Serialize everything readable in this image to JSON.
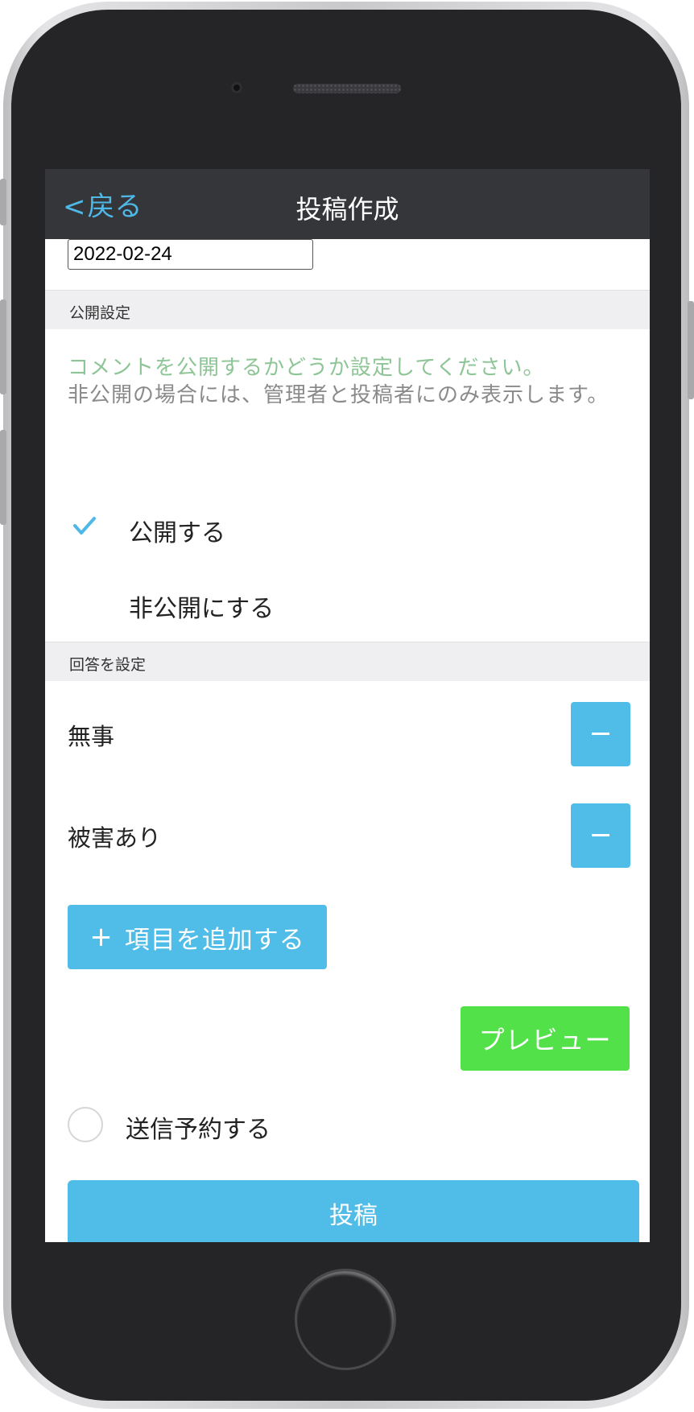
{
  "nav": {
    "back_label": "戻る",
    "back_chevron": "<",
    "title": "投稿作成"
  },
  "date_field": {
    "value": "2022-02-24"
  },
  "visibility": {
    "header": "公開設定",
    "description_highlight": "コメントを公開するかどうか設定してください。",
    "description": "非公開の場合には、管理者と投稿者にのみ表示します。",
    "options": [
      {
        "label": "公開する",
        "selected": true
      },
      {
        "label": "非公開にする",
        "selected": false
      }
    ]
  },
  "answers": {
    "header": "回答を設定",
    "items": [
      {
        "label": "無事"
      },
      {
        "label": "被害あり"
      }
    ],
    "add_label": "項目を追加する",
    "add_icon": "+"
  },
  "preview_label": "プレビュー",
  "schedule": {
    "label": "送信予約する",
    "checked": false
  },
  "submit_label": "投稿",
  "colors": {
    "accent_blue": "#4fbde8",
    "preview_green": "#53e14a",
    "nav_bg": "#34363a",
    "highlight_green": "#8dc596"
  },
  "icons": {
    "check": "check-icon",
    "minus": "minus-icon",
    "plus": "plus-icon",
    "radio": "radio-unchecked-icon"
  }
}
